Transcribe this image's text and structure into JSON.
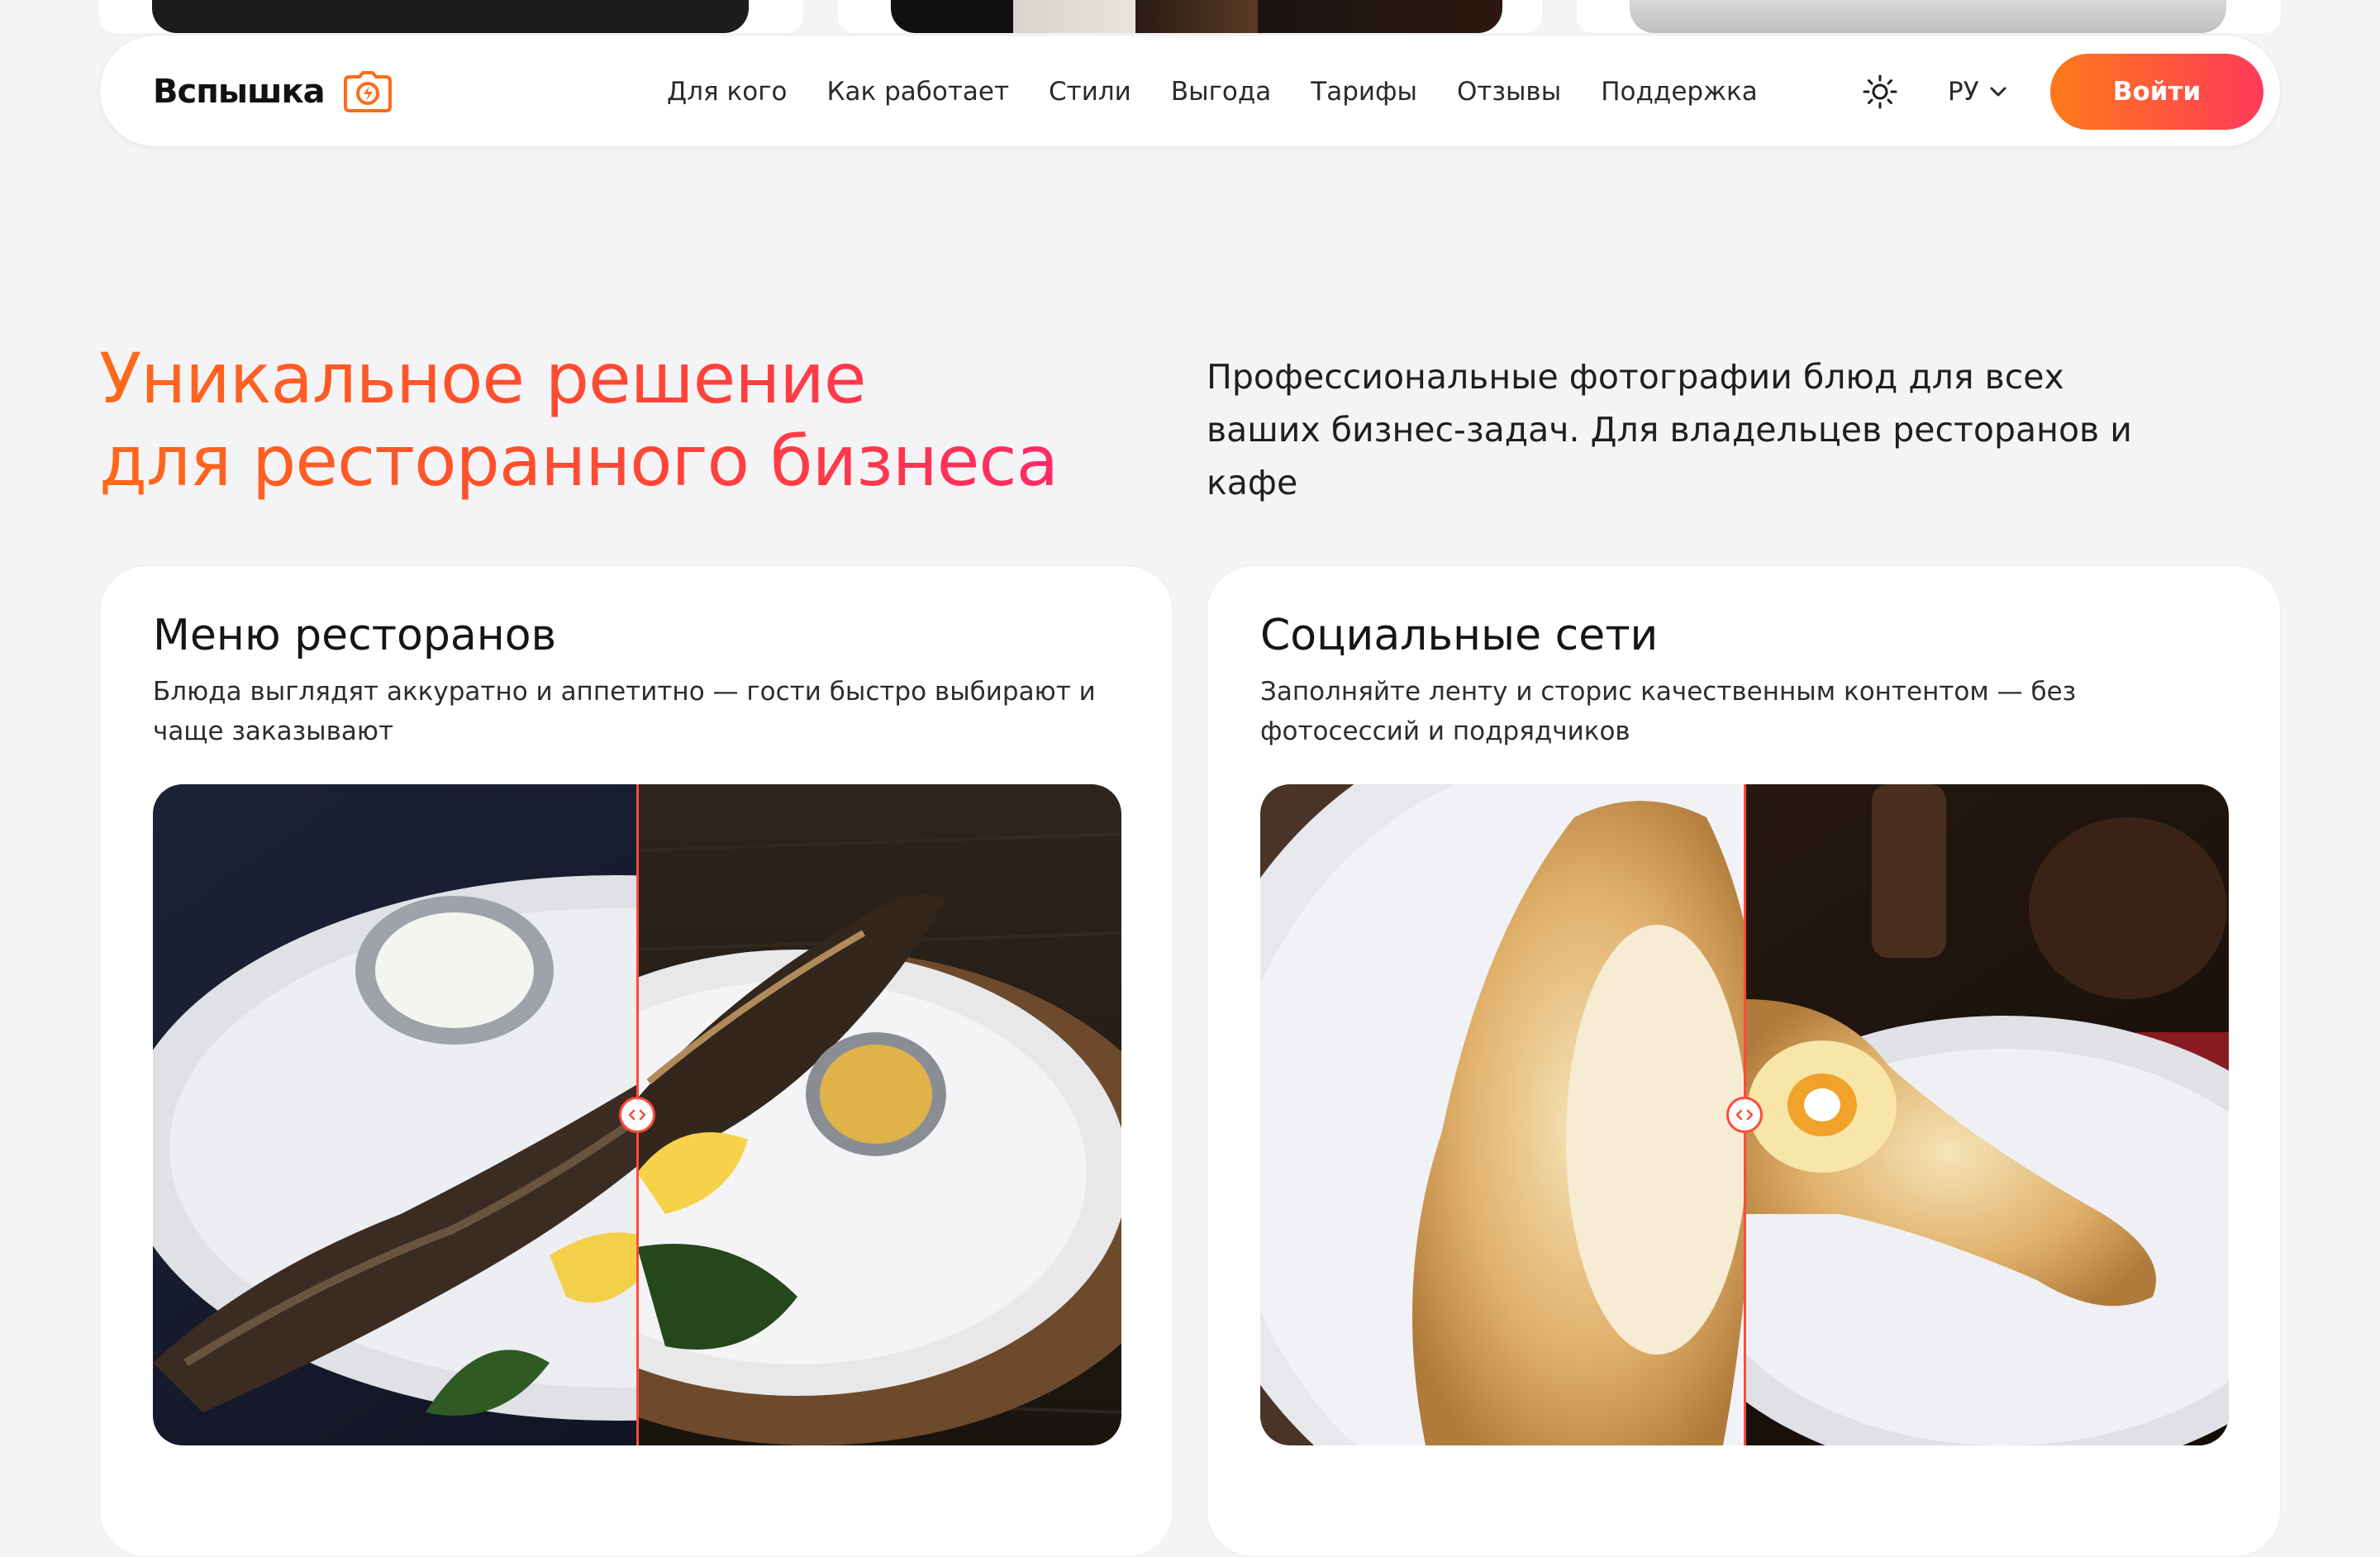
{
  "brand": {
    "name": "Вспышка",
    "accent": "#ff5a2a",
    "gradient": [
      "#ff7a1a",
      "#ff3a5a"
    ]
  },
  "header": {
    "nav": [
      "Для кого",
      "Как работает",
      "Стили",
      "Выгода",
      "Тарифы",
      "Отзывы",
      "Поддержка"
    ],
    "theme_icon": "sun-icon",
    "language": "РУ",
    "login_label": "Войти"
  },
  "hero": {
    "title_line1": "Уникальное решение",
    "title_line2": "для ресторанного бизнеса",
    "subtitle": "Профессиональные фотографии блюд для всех ваших бизнес-задач. Для владельцев ресторанов и кафе"
  },
  "cards": [
    {
      "title": "Меню ресторанов",
      "description": "Блюда выглядят аккуратно и аппетитно — гости быстро выбирают и чаще заказывают",
      "compare_position": 0.5
    },
    {
      "title": "Социальные сети",
      "description": "Заполняйте ленту и сторис качественным контентом — без фотосессий и подрядчиков",
      "compare_position": 0.5
    }
  ]
}
